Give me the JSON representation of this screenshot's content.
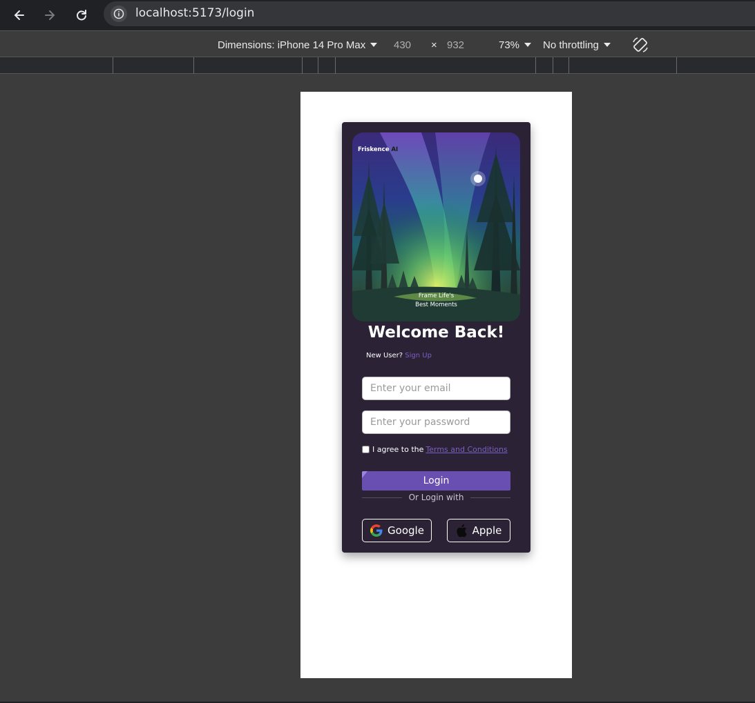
{
  "browser": {
    "url": "localhost:5173/login"
  },
  "device_toolbar": {
    "dimensions_label": "Dimensions: iPhone 14 Pro Max",
    "width": "430",
    "times": "×",
    "height": "932",
    "zoom": "73%",
    "throttling": "No throttling"
  },
  "hero": {
    "brand_name": "Friskence",
    "brand_suffix": "AI",
    "tagline_line1": "Frame Life's",
    "tagline_line2": "Best Moments"
  },
  "login": {
    "title": "Welcome Back!",
    "new_user_text": "New User?",
    "signup_link": "Sign Up",
    "email_placeholder": "Enter your email",
    "password_placeholder": "Enter your password",
    "agree_text": "I agree to the",
    "terms_link": "Terms and Conditions",
    "login_button": "Login",
    "divider_text": "Or Login with",
    "google_button": "Google",
    "apple_button": "Apple"
  },
  "colors": {
    "card_bg": "#2b2235",
    "accent": "#6a4fb3",
    "link": "#7b5fc4"
  }
}
